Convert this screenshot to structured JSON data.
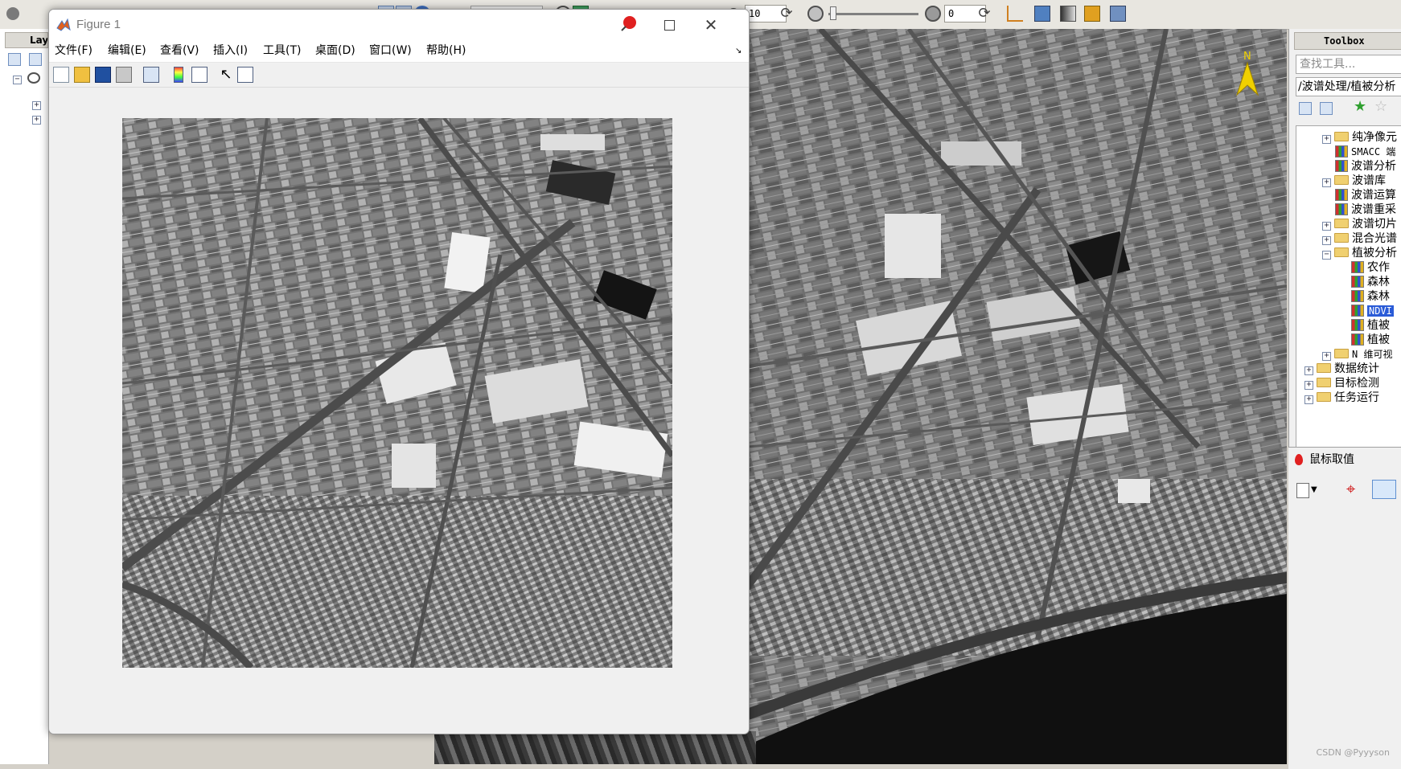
{
  "envi": {
    "layer_tab_label": "Lay",
    "zoom_value": "10",
    "transparency_value": "0",
    "north_label": "N"
  },
  "toolbox": {
    "title": "Toolbox",
    "search_placeholder": "查找工具...",
    "path": "/波谱处理/植被分析",
    "items": [
      {
        "label": "纯净像元",
        "kind": "folder",
        "expander": "+"
      },
      {
        "label": "SMACC 端",
        "kind": "tool"
      },
      {
        "label": "波谱分析",
        "kind": "tool"
      },
      {
        "label": "波谱库",
        "kind": "folder",
        "expander": "+"
      },
      {
        "label": "波谱运算",
        "kind": "tool"
      },
      {
        "label": "波谱重采",
        "kind": "tool"
      },
      {
        "label": "波谱切片",
        "kind": "folder",
        "expander": "+"
      },
      {
        "label": "混合光谱",
        "kind": "folder",
        "expander": "+"
      },
      {
        "label": "植被分析",
        "kind": "folder",
        "expander": "−"
      },
      {
        "label": "农作",
        "kind": "tool"
      },
      {
        "label": "森林",
        "kind": "tool"
      },
      {
        "label": "森林",
        "kind": "tool"
      },
      {
        "label": "NDVI",
        "kind": "tool",
        "selected": true
      },
      {
        "label": "植被",
        "kind": "tool"
      },
      {
        "label": "植被",
        "kind": "tool"
      },
      {
        "label": "N 维可视",
        "kind": "folder",
        "expander": "+"
      },
      {
        "label": "数据统计",
        "kind": "folder",
        "expander": "+"
      },
      {
        "label": "目标检测",
        "kind": "folder",
        "expander": "+"
      },
      {
        "label": "任务运行",
        "kind": "folder",
        "expander": "+"
      }
    ],
    "mouse_value_label": "鼠标取值"
  },
  "figure": {
    "title": "Figure 1",
    "menu": [
      "文件(F)",
      "编辑(E)",
      "查看(V)",
      "插入(I)",
      "工具(T)",
      "桌面(D)",
      "窗口(W)",
      "帮助(H)"
    ]
  },
  "watermark": "CSDN @Pyyyson",
  "colors": {
    "selection": "#2a5bd7",
    "folder": "#f0d070",
    "pin_red": "#e02020",
    "north_arrow": "#f0d000"
  }
}
